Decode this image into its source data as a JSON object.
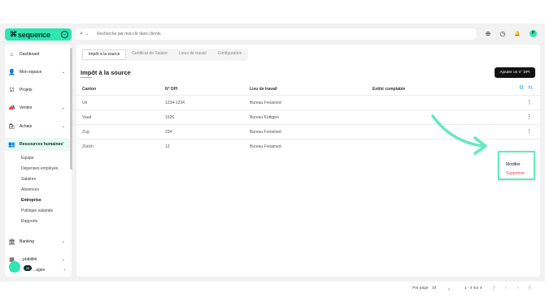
{
  "app": {
    "logo_mark": "⌘",
    "logo_text": "sequence",
    "logo_chevron": "⌄"
  },
  "search": {
    "placeholder": "Recherche par mot-clé dans clients"
  },
  "topbar": {
    "add_icon": "⊕",
    "history_icon": "◷",
    "bell_icon": "🔔",
    "avatar_initial": "P"
  },
  "sidebar": {
    "items": [
      {
        "label": "Dashboard",
        "icon": "home-icon",
        "glyph": "⌂",
        "chevron": ""
      },
      {
        "label": "Mon espace",
        "icon": "user-icon",
        "glyph": "👤",
        "chevron": "⌄"
      },
      {
        "label": "Projets",
        "icon": "check-icon",
        "glyph": "☑",
        "chevron": ""
      },
      {
        "label": "Ventes",
        "icon": "megaphone-icon",
        "glyph": "📣",
        "chevron": "⌄"
      },
      {
        "label": "Achats",
        "icon": "bag-icon",
        "glyph": "🛍",
        "chevron": "⌄"
      },
      {
        "label": "Ressources humaines",
        "icon": "people-icon",
        "glyph": "👥",
        "chevron": "⌃"
      },
      {
        "label": "Banking",
        "icon": "bank-icon",
        "glyph": "🏛",
        "chevron": "⌄"
      },
      {
        "label": "...ptabilité",
        "icon": "calculator-icon",
        "glyph": "▦",
        "chevron": "⌄"
      },
      {
        "label": "...ages",
        "icon": "settings-icon",
        "glyph": "⚙",
        "chevron": "›"
      }
    ],
    "subitems": [
      "Equipe",
      "Dépenses employés",
      "Salaires",
      "Absences",
      "Entreprise",
      "Politique salariale",
      "Rapports"
    ],
    "active_subitem": "Entreprise",
    "badge_count": "25"
  },
  "tabs": [
    {
      "label": "Impôt à la source",
      "active": true
    },
    {
      "label": "Certificat de Salaire",
      "active": false
    },
    {
      "label": "Lieux de travail",
      "active": false
    },
    {
      "label": "Configuration",
      "active": false
    }
  ],
  "page": {
    "title": "Impôt à la source",
    "add_button": "Ajouter un n° DPI"
  },
  "table": {
    "columns": [
      "Canton",
      "N° DPI",
      "Lieu de travail",
      "Entité comptable"
    ],
    "settings_icon": "⚙",
    "columns_icon": "⇆",
    "rows": [
      {
        "canton": "Uri",
        "dpi": "1234-1234",
        "lieu": "Bureau Freiamed",
        "entite": "",
        "menu": "⋮"
      },
      {
        "canton": "Vaud",
        "dpi": "1526",
        "lieu": "Bureau Küttigen",
        "entite": "",
        "menu": "⋮"
      },
      {
        "canton": "Zug",
        "dpi": "234",
        "lieu": "Bureau Freiamed",
        "entite": "",
        "menu": "⋮"
      },
      {
        "canton": "Zürich",
        "dpi": "12",
        "lieu": "Bureau Freiamed",
        "entite": "",
        "menu": ""
      }
    ]
  },
  "dropdown": {
    "edit": "Modifier",
    "delete": "Supprimer",
    "delete_color": "#e5484d"
  },
  "pagination": {
    "per_page_label": "Par page",
    "per_page_value": "10",
    "range": "1 - 4 sur 4",
    "first": "|‹",
    "prev": "‹",
    "next": "›",
    "last": "›|"
  },
  "colors": {
    "brand": "#2ee6b1",
    "highlight": "#63e9c0",
    "accent_icon": "#2aa7e0"
  }
}
